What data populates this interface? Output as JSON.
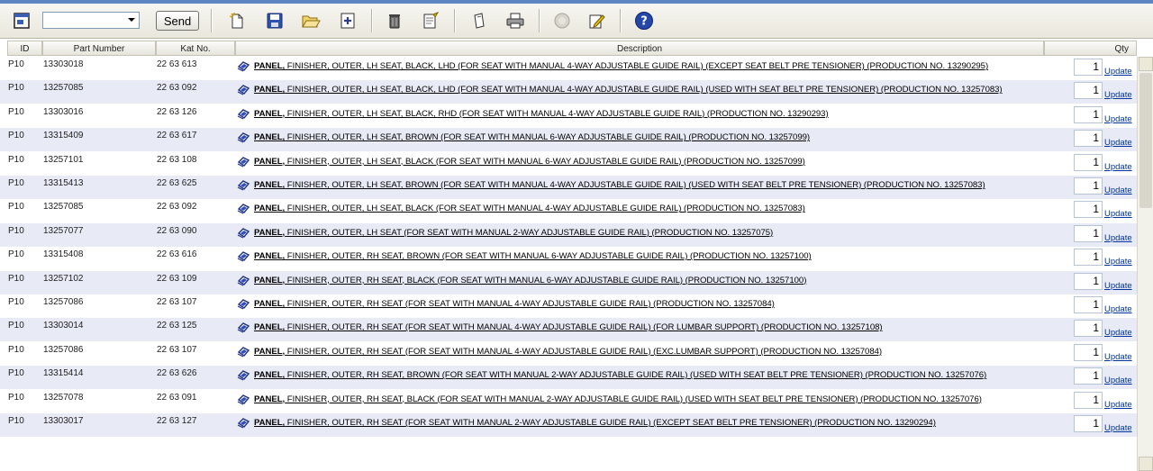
{
  "toolbar": {
    "send_label": "Send",
    "combo_value": "",
    "icons": [
      "screen-icon",
      "new-document-icon",
      "save-icon",
      "open-folder-icon",
      "add-icon",
      "trash-icon",
      "edit-list-icon",
      "bookmark-icon",
      "print-icon",
      "disabled-circle-icon",
      "edit-pencil-icon",
      "help-icon"
    ]
  },
  "columns": {
    "id": "ID",
    "part_number": "Part Number",
    "kat_no": "Kat No.",
    "description": "Description",
    "qty": "Qty"
  },
  "update_label": "Update",
  "rows": [
    {
      "id": "P10",
      "part": "13303018",
      "kat": "22 63 613",
      "desc_head": "PANEL,",
      "desc_rest": " FINISHER, OUTER, LH SEAT, BLACK, LHD (FOR SEAT WITH MANUAL 4-WAY ADJUSTABLE GUIDE RAIL) (EXCEPT SEAT BELT PRE TENSIONER) (PRODUCTION NO. 13290295)",
      "qty": "1"
    },
    {
      "id": "P10",
      "part": "13257085",
      "kat": "22 63 092",
      "desc_head": "PANEL,",
      "desc_rest": " FINISHER, OUTER, LH SEAT, BLACK, LHD (FOR SEAT WITH MANUAL 4-WAY ADJUSTABLE GUIDE RAIL) (USED WITH SEAT BELT PRE TENSIONER) (PRODUCTION NO. 13257083)",
      "qty": "1"
    },
    {
      "id": "P10",
      "part": "13303016",
      "kat": "22 63 126",
      "desc_head": "PANEL,",
      "desc_rest": " FINISHER, OUTER, LH SEAT, BLACK, RHD (FOR SEAT WITH MANUAL 4-WAY ADJUSTABLE GUIDE RAIL) (PRODUCTION NO. 13290293)",
      "qty": "1"
    },
    {
      "id": "P10",
      "part": "13315409",
      "kat": "22 63 617",
      "desc_head": "PANEL,",
      "desc_rest": " FINISHER, OUTER, LH SEAT, BROWN (FOR SEAT WITH MANUAL 6-WAY ADJUSTABLE GUIDE RAIL) (PRODUCTION NO. 13257099)",
      "qty": "1"
    },
    {
      "id": "P10",
      "part": "13257101",
      "kat": "22 63 108",
      "desc_head": "PANEL,",
      "desc_rest": " FINISHER, OUTER, LH SEAT, BLACK (FOR SEAT WITH MANUAL 6-WAY ADJUSTABLE GUIDE RAIL) (PRODUCTION NO. 13257099)",
      "qty": "1"
    },
    {
      "id": "P10",
      "part": "13315413",
      "kat": "22 63 625",
      "desc_head": "PANEL,",
      "desc_rest": " FINISHER, OUTER, LH SEAT, BROWN (FOR SEAT WITH MANUAL 4-WAY ADJUSTABLE GUIDE RAIL) (USED WITH SEAT BELT PRE TENSIONER) (PRODUCTION NO. 13257083)",
      "qty": "1"
    },
    {
      "id": "P10",
      "part": "13257085",
      "kat": "22 63 092",
      "desc_head": "PANEL,",
      "desc_rest": " FINISHER, OUTER, LH SEAT, BLACK (FOR SEAT WITH MANUAL 4-WAY ADJUSTABLE GUIDE RAIL) (PRODUCTION NO. 13257083)",
      "qty": "1"
    },
    {
      "id": "P10",
      "part": "13257077",
      "kat": "22 63 090",
      "desc_head": "PANEL,",
      "desc_rest": " FINISHER, OUTER, LH SEAT (FOR SEAT WITH MANUAL 2-WAY ADJUSTABLE GUIDE RAIL) (PRODUCTION NO. 13257075)",
      "qty": "1"
    },
    {
      "id": "P10",
      "part": "13315408",
      "kat": "22 63 616",
      "desc_head": "PANEL,",
      "desc_rest": " FINISHER, OUTER, RH SEAT, BROWN (FOR SEAT WITH MANUAL 6-WAY ADJUSTABLE GUIDE RAIL) (PRODUCTION NO. 13257100)",
      "qty": "1"
    },
    {
      "id": "P10",
      "part": "13257102",
      "kat": "22 63 109",
      "desc_head": "PANEL,",
      "desc_rest": " FINISHER, OUTER, RH SEAT, BLACK (FOR SEAT WITH MANUAL 6-WAY ADJUSTABLE GUIDE RAIL) (PRODUCTION NO. 13257100)",
      "qty": "1"
    },
    {
      "id": "P10",
      "part": "13257086",
      "kat": "22 63 107",
      "desc_head": "PANEL,",
      "desc_rest": " FINISHER, OUTER, RH SEAT (FOR SEAT WITH MANUAL 4-WAY ADJUSTABLE GUIDE RAIL) (PRODUCTION NO. 13257084)",
      "qty": "1"
    },
    {
      "id": "P10",
      "part": "13303014",
      "kat": "22 63 125",
      "desc_head": "PANEL,",
      "desc_rest": " FINISHER, OUTER, RH SEAT (FOR SEAT WITH MANUAL 4-WAY ADJUSTABLE GUIDE RAIL) (FOR LUMBAR SUPPORT) (PRODUCTION NO. 13257108)",
      "qty": "1"
    },
    {
      "id": "P10",
      "part": "13257086",
      "kat": "22 63 107",
      "desc_head": "PANEL,",
      "desc_rest": " FINISHER, OUTER, RH SEAT (FOR SEAT WITH MANUAL 4-WAY ADJUSTABLE GUIDE RAIL) (EXC.LUMBAR SUPPORT) (PRODUCTION NO. 13257084)",
      "qty": "1"
    },
    {
      "id": "P10",
      "part": "13315414",
      "kat": "22 63 626",
      "desc_head": "PANEL,",
      "desc_rest": " FINISHER, OUTER, RH SEAT, BROWN (FOR SEAT WITH MANUAL 2-WAY ADJUSTABLE GUIDE RAIL) (USED WITH SEAT BELT PRE TENSIONER) (PRODUCTION NO. 13257076)",
      "qty": "1"
    },
    {
      "id": "P10",
      "part": "13257078",
      "kat": "22 63 091",
      "desc_head": "PANEL,",
      "desc_rest": " FINISHER, OUTER, RH SEAT, BLACK (FOR SEAT WITH MANUAL 2-WAY ADJUSTABLE GUIDE RAIL) (USED WITH SEAT BELT PRE TENSIONER) (PRODUCTION NO. 13257076)",
      "qty": "1"
    },
    {
      "id": "P10",
      "part": "13303017",
      "kat": "22 63 127",
      "desc_head": "PANEL,",
      "desc_rest": " FINISHER, OUTER, RH SEAT (FOR SEAT WITH MANUAL 2-WAY ADJUSTABLE GUIDE RAIL) (EXCEPT SEAT BELT PRE TENSIONER) (PRODUCTION NO. 13290294)",
      "qty": "1"
    }
  ]
}
